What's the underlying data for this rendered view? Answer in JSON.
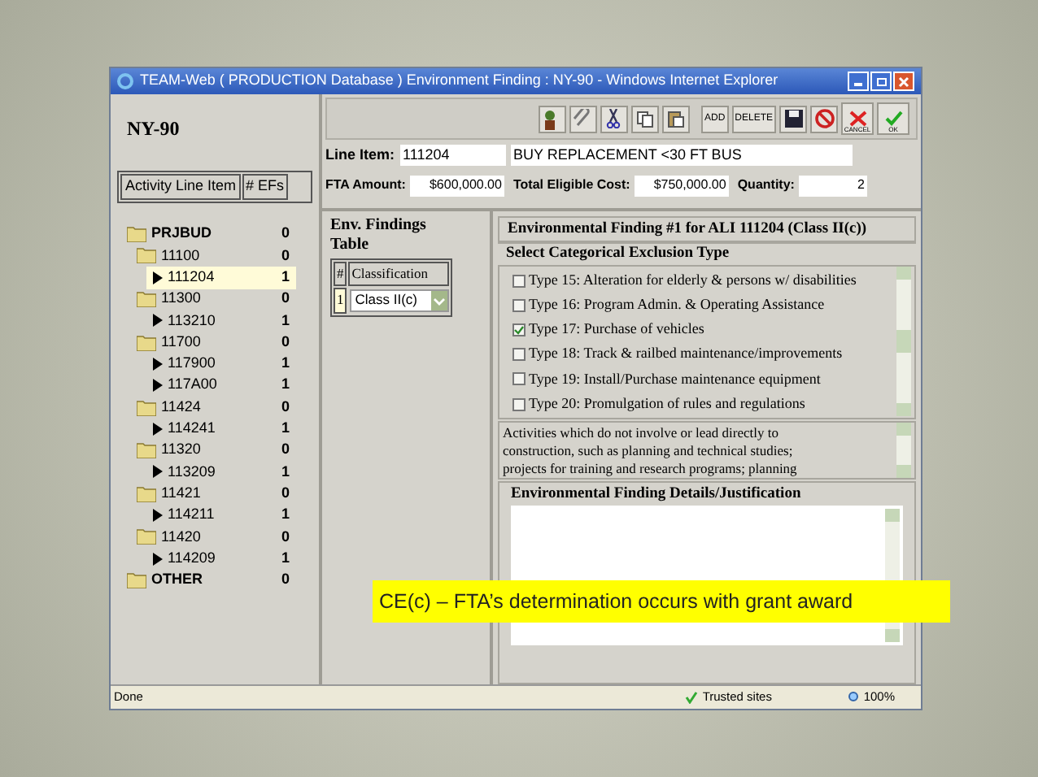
{
  "window": {
    "title": "TEAM-Web ( PRODUCTION Database ) Environment Finding : NY-90 - Windows Internet Explorer"
  },
  "project": {
    "title": "NY-90"
  },
  "tree_header": {
    "columns": [
      "Activity Line Item",
      "# EFs"
    ]
  },
  "tree": [
    {
      "label": "PRJBUD",
      "count": "0",
      "selected": false,
      "children": [
        {
          "label": "11100",
          "count": "0",
          "selected": false,
          "children": [
            {
              "label": "111204",
              "count": "1",
              "selected": true
            }
          ]
        },
        {
          "label": "11300",
          "count": "0",
          "selected": false,
          "children": [
            {
              "label": "113210",
              "count": "1",
              "selected": false
            }
          ]
        },
        {
          "label": "11700",
          "count": "0",
          "selected": false,
          "children": [
            {
              "label": "117900",
              "count": "1",
              "selected": false
            },
            {
              "label": "117A00",
              "count": "1",
              "selected": false
            }
          ]
        },
        {
          "label": "11424",
          "count": "0",
          "selected": false,
          "children": [
            {
              "label": "114241",
              "count": "1",
              "selected": false
            }
          ]
        },
        {
          "label": "11320",
          "count": "0",
          "selected": false,
          "children": [
            {
              "label": "113209",
              "count": "1",
              "selected": false
            }
          ]
        },
        {
          "label": "11421",
          "count": "0",
          "selected": false,
          "children": [
            {
              "label": "114211",
              "count": "1",
              "selected": false
            }
          ]
        },
        {
          "label": "11420",
          "count": "0",
          "selected": false,
          "children": [
            {
              "label": "114209",
              "count": "1",
              "selected": false
            }
          ]
        }
      ]
    },
    {
      "label": "OTHER",
      "count": "0",
      "selected": false
    }
  ],
  "toolbar": {
    "text_buttons": [
      "ADD",
      "DELETE"
    ],
    "cancel_label": "CANCEL",
    "ok_label": "OK"
  },
  "line_item": {
    "label": "Line Item:",
    "code": "111204",
    "description": "BUY REPLACEMENT <30 FT BUS"
  },
  "amounts": [
    {
      "label": "FTA Amount:",
      "value": "$600,000.00"
    },
    {
      "label": "Total Eligible Cost:",
      "value": "$750,000.00"
    },
    {
      "label": "Quantity:",
      "value": "2"
    }
  ],
  "env_table": {
    "title": "Env. Findings Table",
    "columns": [
      "#",
      "Classification"
    ],
    "rows": [
      {
        "number": "1",
        "classification": "Class II(c)"
      }
    ]
  },
  "finding": {
    "title": "Environmental Finding #1 for ALI 111204 (Class II(c))",
    "select_heading": "Select Categorical Exclusion Type",
    "types": [
      {
        "label": "Type 15: Alteration for elderly & persons w/ disabilities",
        "checked": false
      },
      {
        "label": "Type 16: Program Admin. & Operating Assistance",
        "checked": false
      },
      {
        "label": "Type 17: Purchase of vehicles",
        "checked": true
      },
      {
        "label": "Type 18: Track & railbed maintenance/improvements",
        "checked": false
      },
      {
        "label": "Type 19: Install/Purchase maintenance equipment",
        "checked": false
      },
      {
        "label": "Type 20: Promulgation of rules and regulations",
        "checked": false
      }
    ],
    "description": "Activities which do not involve or lead directly to construction, such as planning and technical studies; projects for training and research programs; planning",
    "details_heading": "Environmental Finding Details/Justification"
  },
  "status_bar": {
    "status": "Done",
    "zone": "Trusted sites",
    "zoom": "100%"
  },
  "caption": "CE(c) – FTA’s determination occurs with grant award"
}
